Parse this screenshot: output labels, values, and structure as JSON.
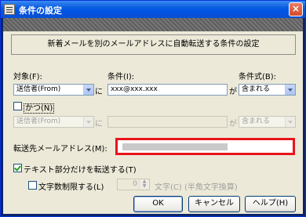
{
  "window": {
    "title": "条件の設定",
    "close_label": "×"
  },
  "description": "新着メールを別のメールアドレスに自動転送する条件の設定",
  "row1": {
    "target_label": "対象(F):",
    "target_value": "送信者(From)",
    "ni": "に",
    "condition_label": "条件(I):",
    "condition_value": "xxx@xxx.xxx",
    "ga": "が",
    "formula_label": "条件式(B):",
    "formula_value": "含まれる"
  },
  "katsu": {
    "label": "かつ(N)",
    "checked": false
  },
  "row2": {
    "target_value": "送信者(From)",
    "ni": "に",
    "ga": "が",
    "formula_value": "含まれる"
  },
  "forward_label": "転送先メールアドレス(M):",
  "text_only": {
    "label": "テキスト部分だけを転送する(T)",
    "checked": true
  },
  "char_limit": {
    "label": "文字数制限する(L)",
    "value": "0",
    "unit": "文字(C) (半角文字換算)",
    "checked": false
  },
  "buttons": {
    "ok": "OK",
    "cancel": "キャンセル",
    "help": "ヘルプ(H)"
  },
  "colors": {
    "title_bar": "#0054e3",
    "highlight_border": "#e8141b",
    "dialog_bg": "#ece9d8"
  }
}
